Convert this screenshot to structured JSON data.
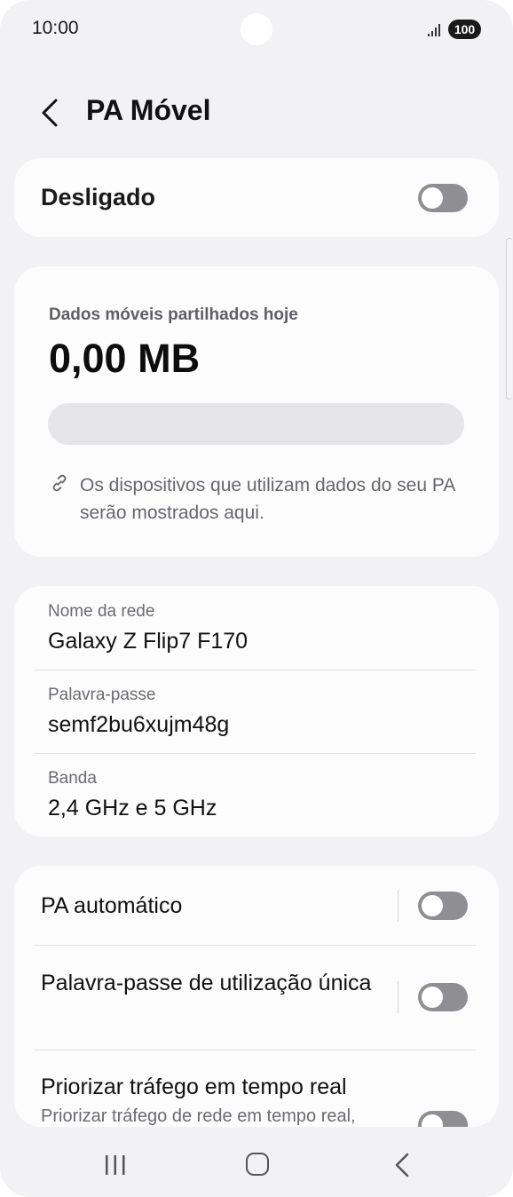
{
  "status_bar": {
    "time": "10:00",
    "battery": "100"
  },
  "header": {
    "title": "PA Móvel"
  },
  "hotspot": {
    "label": "Desligado",
    "enabled": false
  },
  "data_usage": {
    "label": "Dados móveis partilhados hoje",
    "value": "0,00 MB",
    "progress": 0,
    "note": "Os dispositivos que utilizam dados do seu PA serão mostrados aqui."
  },
  "network": {
    "name_label": "Nome da rede",
    "name_value": "Galaxy Z Flip7 F170",
    "password_label": "Palavra-passe",
    "password_value": "semf2bu6xujm48g",
    "band_label": "Banda",
    "band_value": "2,4 GHz e 5 GHz"
  },
  "settings": {
    "auto_hotspot": {
      "label": "PA automático",
      "enabled": false
    },
    "one_time_password": {
      "label": "Palavra-passe de utilização única",
      "enabled": false
    },
    "realtime_traffic": {
      "label": "Priorizar tráfego em tempo real",
      "sub": "Priorizar tráfego de rede em tempo real,",
      "enabled": false
    }
  },
  "colors": {
    "background": "#f2f2f4",
    "card": "#fcfcfd",
    "switch_off": "#8e8e93",
    "accent": "#3e91ff"
  }
}
